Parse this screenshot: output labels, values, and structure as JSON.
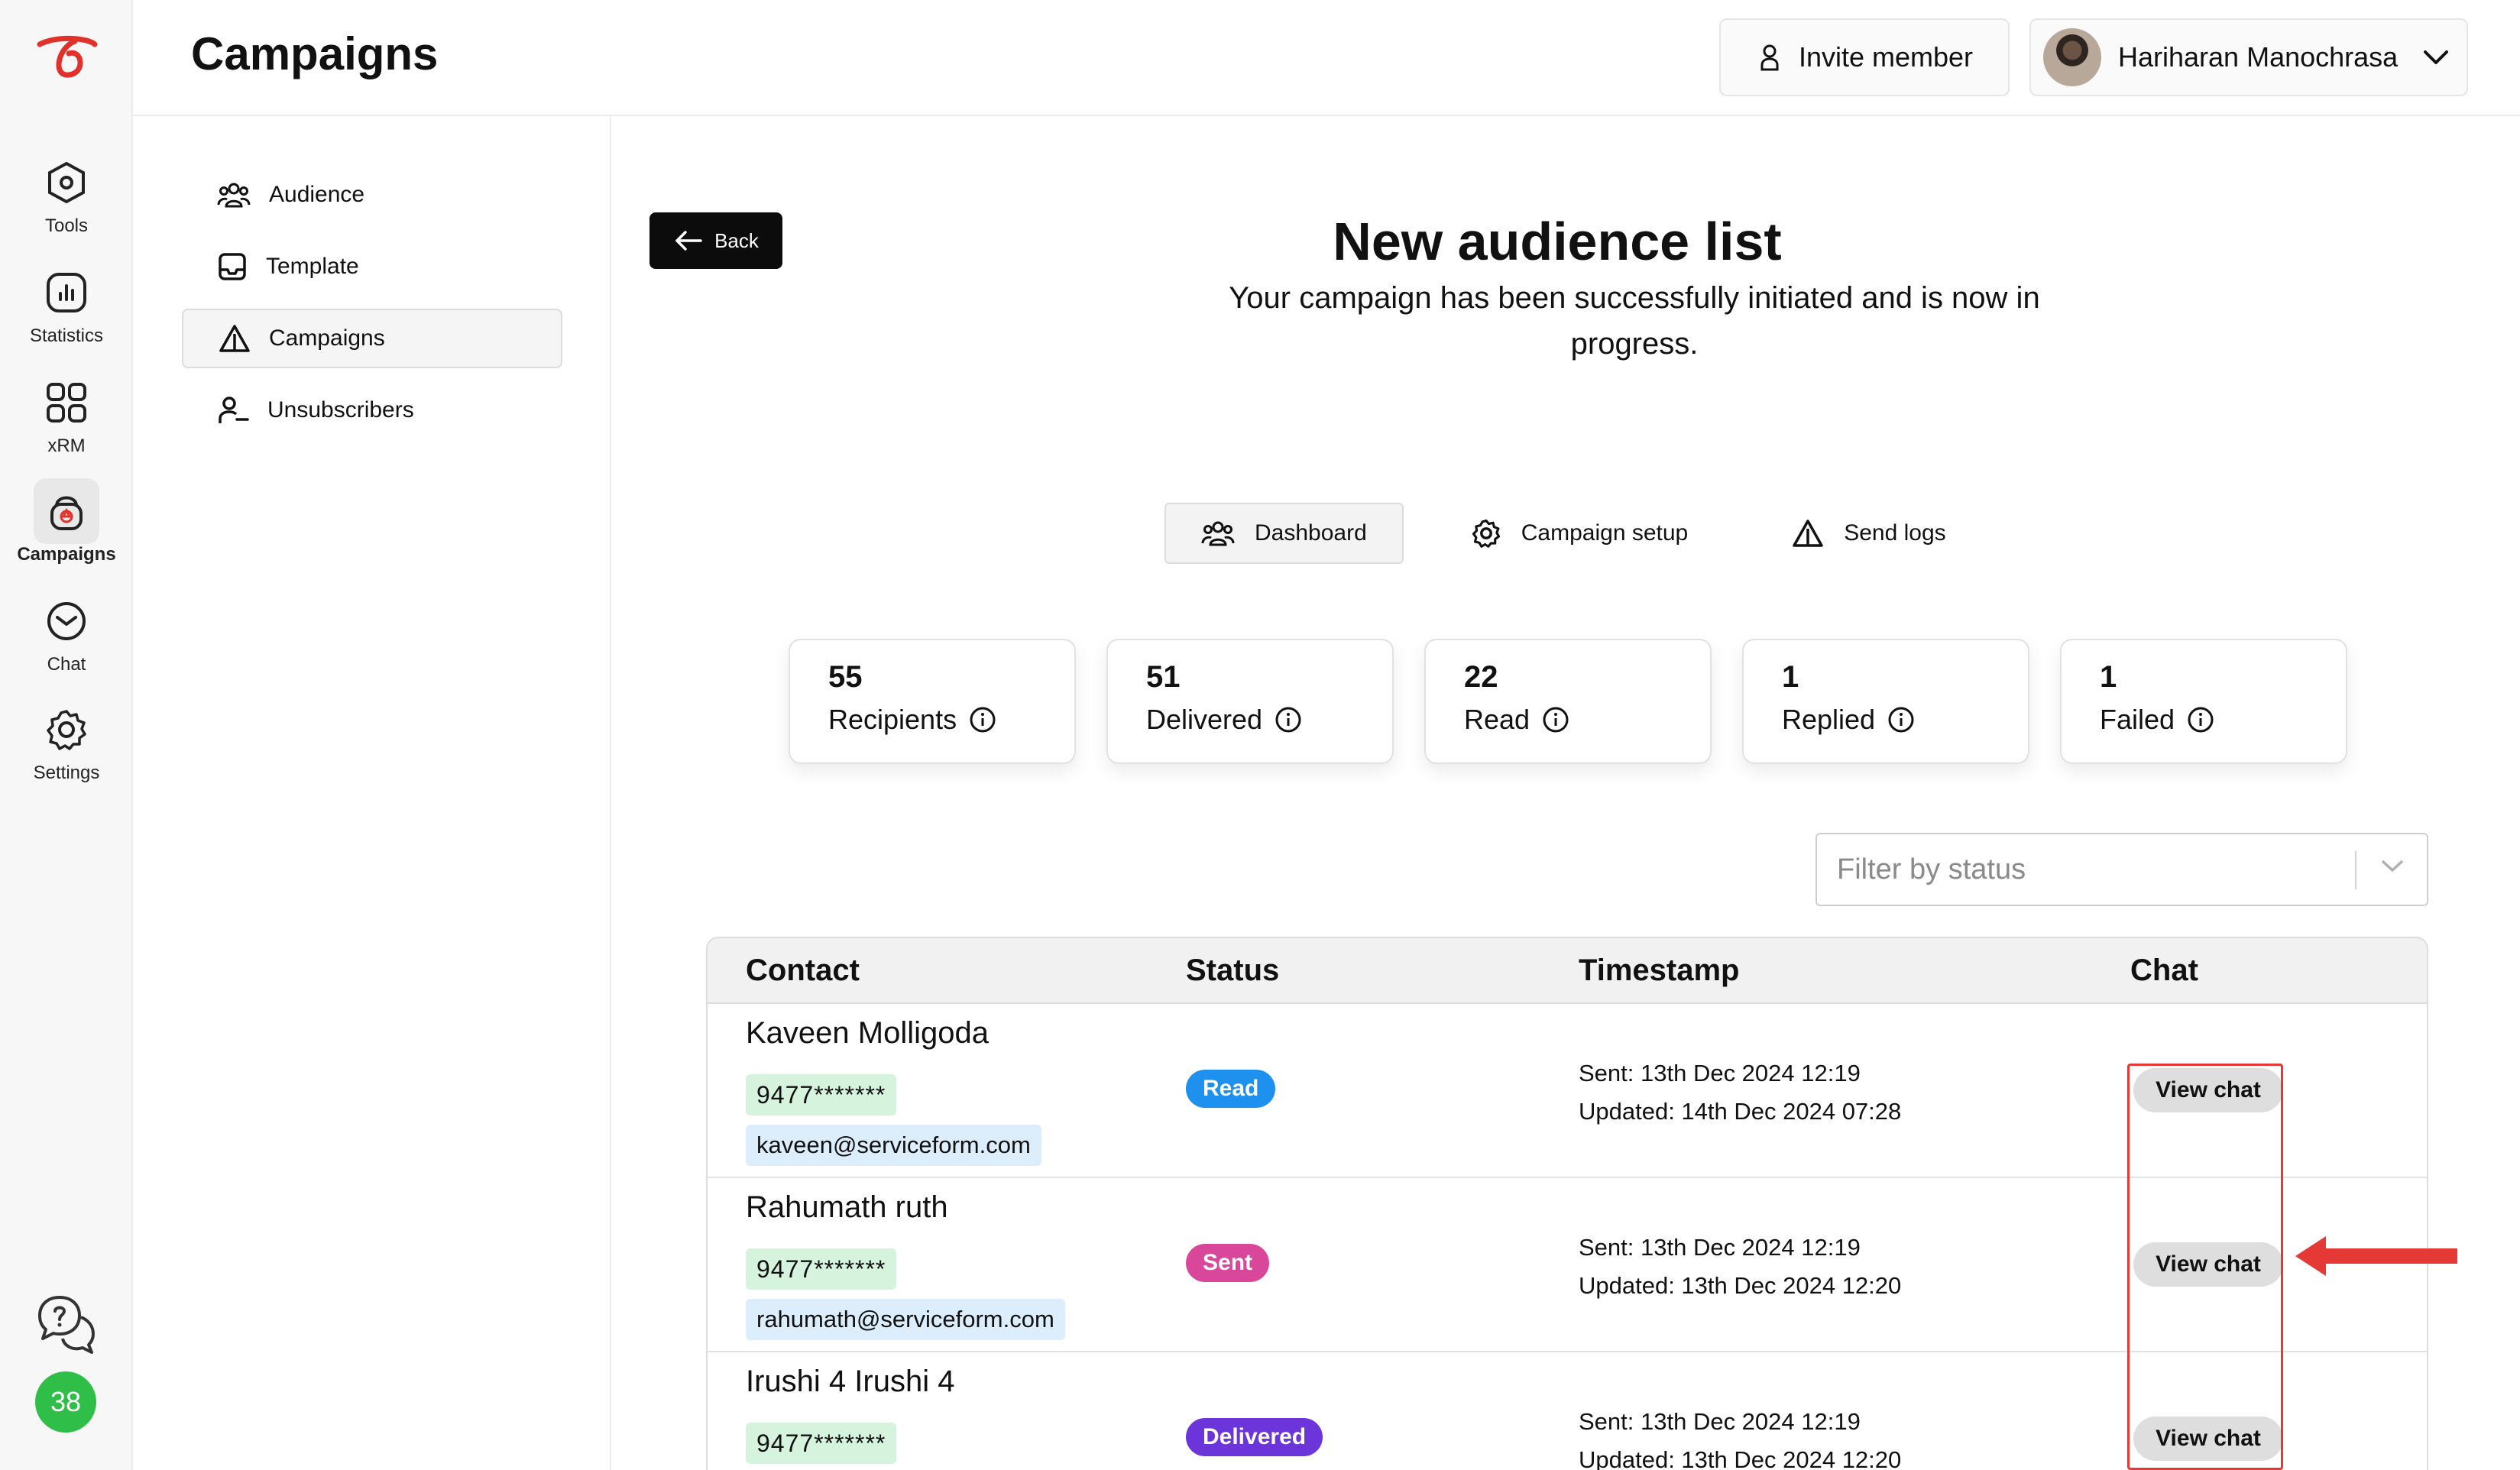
{
  "rail": {
    "items": [
      {
        "label": "Tools",
        "icon": "hexagon-icon"
      },
      {
        "label": "Statistics",
        "icon": "bar-chart-icon"
      },
      {
        "label": "xRM",
        "icon": "grid-icon"
      },
      {
        "label": "Campaigns",
        "icon": "campaign-icon"
      },
      {
        "label": "Chat",
        "icon": "chat-icon"
      },
      {
        "label": "Settings",
        "icon": "gear-icon"
      }
    ],
    "active": "Campaigns",
    "badge_count": "38"
  },
  "header": {
    "title": "Campaigns",
    "invite_label": "Invite member",
    "user_name": "Hariharan Manochrasa"
  },
  "subnav": {
    "items": [
      {
        "label": "Audience",
        "icon": "people-icon"
      },
      {
        "label": "Template",
        "icon": "template-icon"
      },
      {
        "label": "Campaigns",
        "icon": "warning-triangle-icon"
      },
      {
        "label": "Unsubscribers",
        "icon": "user-minus-icon"
      }
    ],
    "active": "Campaigns"
  },
  "main": {
    "back_label": "Back",
    "title": "New audience list",
    "subtitle": "Your campaign has been successfully initiated and is now in progress.",
    "tabs": [
      {
        "label": "Dashboard",
        "icon": "people-icon"
      },
      {
        "label": "Campaign setup",
        "icon": "gear-icon"
      },
      {
        "label": "Send logs",
        "icon": "warning-triangle-icon"
      }
    ],
    "active_tab": "Dashboard",
    "stats": [
      {
        "value": "55",
        "label": "Recipients"
      },
      {
        "value": "51",
        "label": "Delivered"
      },
      {
        "value": "22",
        "label": "Read"
      },
      {
        "value": "1",
        "label": "Replied"
      },
      {
        "value": "1",
        "label": "Failed"
      }
    ],
    "filter_placeholder": "Filter by status"
  },
  "table": {
    "columns": [
      "Contact",
      "Status",
      "Timestamp",
      "Chat"
    ],
    "rows": [
      {
        "name": "Kaveen Molligoda",
        "phone": "9477*******",
        "email": "kaveen@serviceform.com",
        "status": "Read",
        "status_color": "#1e90ee",
        "sent": "Sent: 13th Dec 2024 12:19",
        "updated": "Updated: 14th Dec 2024 07:28",
        "action": "View chat"
      },
      {
        "name": "Rahumath ruth",
        "phone": "9477*******",
        "email": "rahumath@serviceform.com",
        "status": "Sent",
        "status_color": "#d9479a",
        "sent": "Sent: 13th Dec 2024 12:19",
        "updated": "Updated: 13th Dec 2024 12:20",
        "action": "View chat"
      },
      {
        "name": "Irushi 4 Irushi 4",
        "phone": "9477*******",
        "email": "",
        "status": "Delivered",
        "status_color": "#6c35d9",
        "sent": "Sent: 13th Dec 2024 12:19",
        "updated": "Updated: 13th Dec 2024 12:20",
        "action": "View chat"
      }
    ]
  },
  "colors": {
    "annotation": "#e53935",
    "badge_green": "#2fbf48",
    "phone_bg": "#d5f3dd",
    "email_bg": "#dceefc"
  }
}
